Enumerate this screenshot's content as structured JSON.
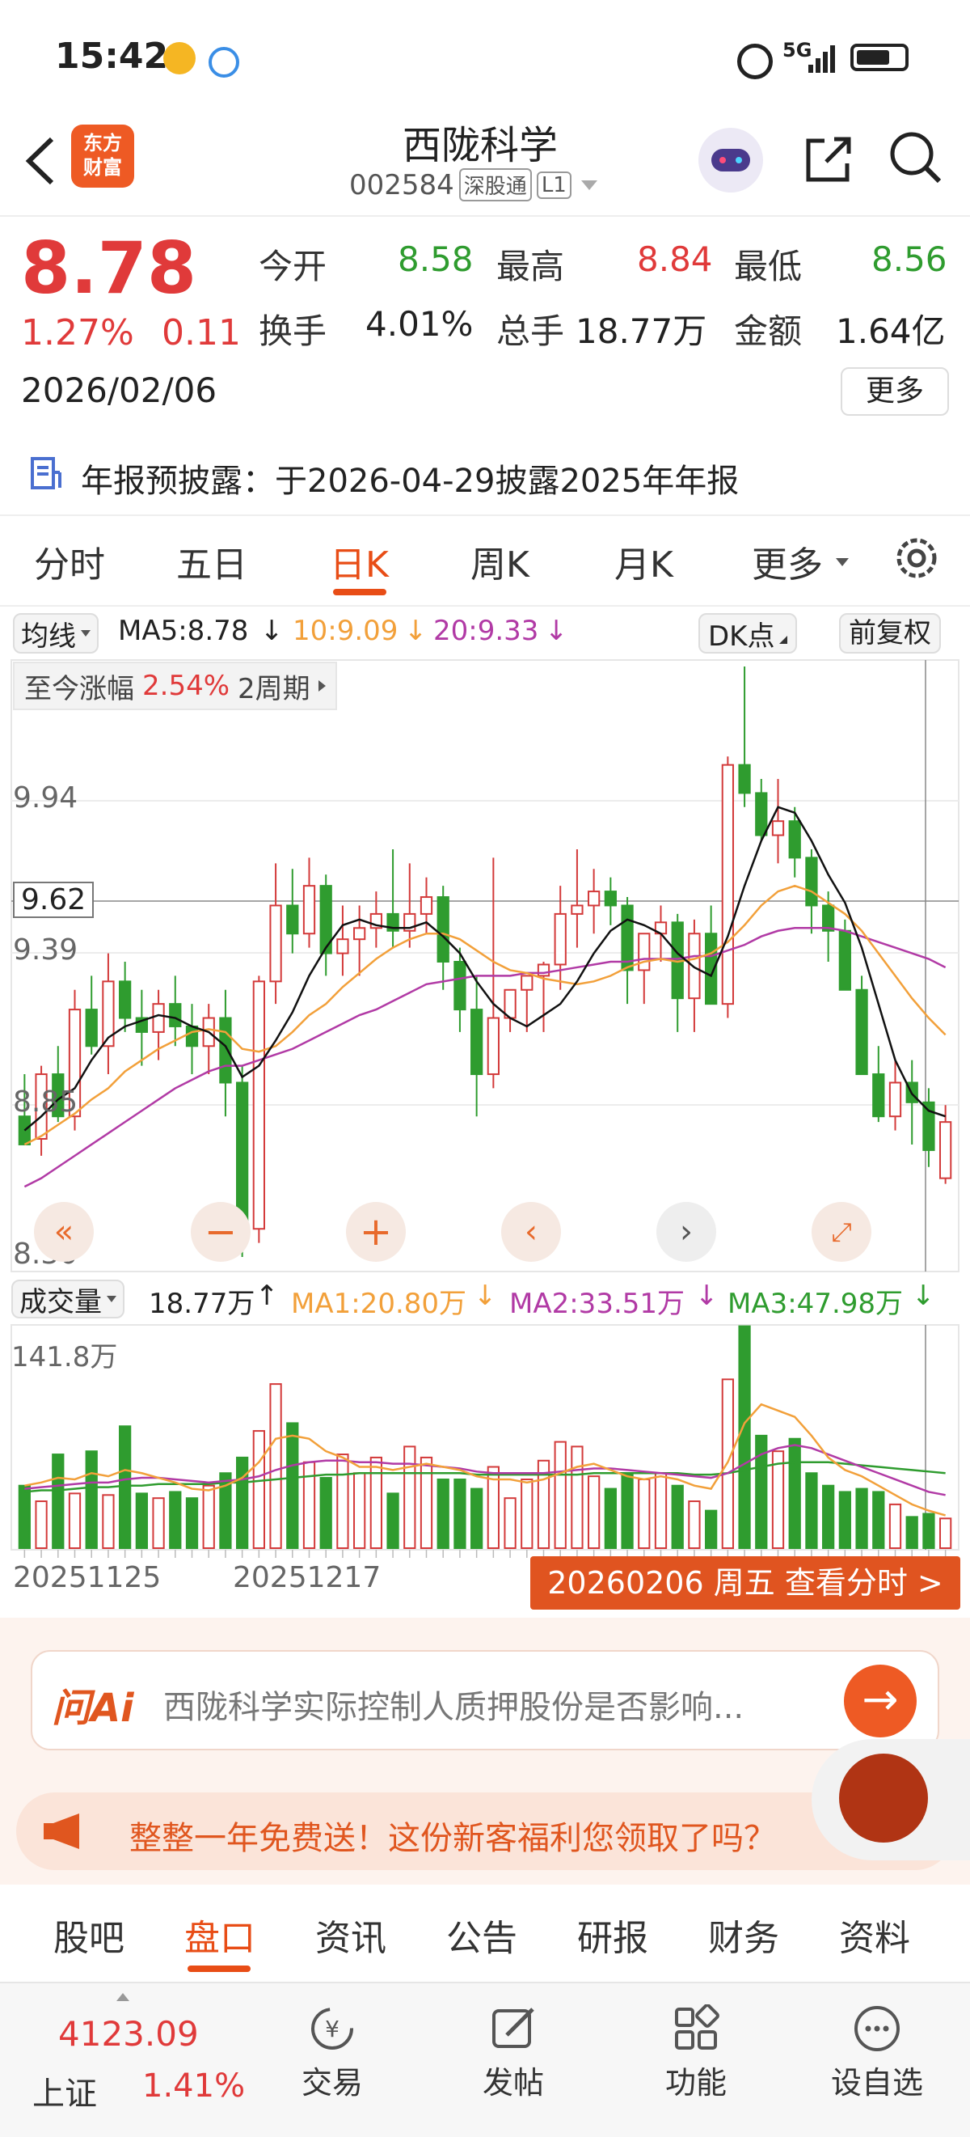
{
  "status_bar": {
    "time": "15:42",
    "network": "5G"
  },
  "header": {
    "logo_text": "东方财富",
    "stock_name": "西陇科学",
    "stock_code": "002584",
    "connect_badge": "深股通",
    "level_badge": "L1"
  },
  "quote": {
    "price": "8.78",
    "change_pct": "1.27%",
    "change_amt": "0.11",
    "date": "2026/02/06",
    "fields": [
      {
        "label": "今开",
        "value": "8.58",
        "color": "green"
      },
      {
        "label": "最高",
        "value": "8.84",
        "color": "red"
      },
      {
        "label": "最低",
        "value": "8.56",
        "color": "green"
      },
      {
        "label": "换手",
        "value": "4.01%",
        "color": "normal"
      },
      {
        "label": "总手",
        "value": "18.77万",
        "color": "normal"
      },
      {
        "label": "金额",
        "value": "1.64亿",
        "color": "normal"
      }
    ],
    "more_label": "更多"
  },
  "notice": {
    "text": "年报预披露：于2026-04-29披露2025年年报"
  },
  "chart_tabs": {
    "items": [
      "分时",
      "五日",
      "日K",
      "周K",
      "月K",
      "更多"
    ],
    "active_index": 2
  },
  "indicators": {
    "ma_selector": "均线",
    "ma5": "MA5:8.78",
    "ma10": "10:9.09",
    "ma20": "20:9.33",
    "dk_label": "DK点",
    "adjust_label": "前复权",
    "range_label": "至今涨幅",
    "range_value": "2.54%",
    "range_period": "2周期",
    "crosshair_price": "9.62"
  },
  "colors": {
    "up": "#d33a3a",
    "down": "#2f9c2f",
    "ma5": "#111111",
    "ma10": "#f2a03a",
    "ma20": "#b13aa5",
    "accent": "#e84d16"
  },
  "chart_data": [
    {
      "type": "candlestick",
      "y_ticks": [
        "9.94",
        "9.39",
        "8.85",
        "8.30"
      ],
      "ylim": [
        8.3,
        10.4
      ],
      "ohlc": [
        [
          8.8,
          8.95,
          8.72,
          8.7
        ],
        [
          8.72,
          8.98,
          8.66,
          8.95
        ],
        [
          8.95,
          9.05,
          8.78,
          8.8
        ],
        [
          8.8,
          9.25,
          8.75,
          9.18
        ],
        [
          9.18,
          9.3,
          9.02,
          9.05
        ],
        [
          9.05,
          9.38,
          8.95,
          9.28
        ],
        [
          9.28,
          9.35,
          9.1,
          9.15
        ],
        [
          9.15,
          9.25,
          8.98,
          9.1
        ],
        [
          9.1,
          9.25,
          9.0,
          9.2
        ],
        [
          9.2,
          9.3,
          9.05,
          9.12
        ],
        [
          9.12,
          9.2,
          8.95,
          9.05
        ],
        [
          9.05,
          9.2,
          8.95,
          9.15
        ],
        [
          9.15,
          9.25,
          8.8,
          8.92
        ],
        [
          8.92,
          8.98,
          8.3,
          8.4
        ],
        [
          8.4,
          9.3,
          8.35,
          9.28
        ],
        [
          9.28,
          9.7,
          9.2,
          9.55
        ],
        [
          9.55,
          9.68,
          9.38,
          9.45
        ],
        [
          9.45,
          9.72,
          9.4,
          9.62
        ],
        [
          9.62,
          9.66,
          9.3,
          9.38
        ],
        [
          9.38,
          9.55,
          9.3,
          9.43
        ],
        [
          9.43,
          9.55,
          9.3,
          9.47
        ],
        [
          9.47,
          9.6,
          9.4,
          9.52
        ],
        [
          9.52,
          9.75,
          9.4,
          9.46
        ],
        [
          9.46,
          9.7,
          9.4,
          9.52
        ],
        [
          9.52,
          9.65,
          9.45,
          9.58
        ],
        [
          9.58,
          9.62,
          9.25,
          9.35
        ],
        [
          9.35,
          9.4,
          9.1,
          9.18
        ],
        [
          9.18,
          9.3,
          8.8,
          8.95
        ],
        [
          8.95,
          9.72,
          8.9,
          9.15
        ],
        [
          9.15,
          9.25,
          9.1,
          9.25
        ],
        [
          9.25,
          9.28,
          9.1,
          9.3
        ],
        [
          9.3,
          9.35,
          9.1,
          9.34
        ],
        [
          9.34,
          9.62,
          9.25,
          9.52
        ],
        [
          9.52,
          9.75,
          9.4,
          9.55
        ],
        [
          9.55,
          9.68,
          9.45,
          9.6
        ],
        [
          9.6,
          9.65,
          9.48,
          9.55
        ],
        [
          9.55,
          9.58,
          9.2,
          9.32
        ],
        [
          9.32,
          9.45,
          9.2,
          9.45
        ],
        [
          9.45,
          9.55,
          9.35,
          9.49
        ],
        [
          9.49,
          9.52,
          9.1,
          9.22
        ],
        [
          9.22,
          9.5,
          9.1,
          9.45
        ],
        [
          9.45,
          9.55,
          9.2,
          9.2
        ],
        [
          9.2,
          10.08,
          9.15,
          10.05
        ],
        [
          10.05,
          10.4,
          9.9,
          9.95
        ],
        [
          9.95,
          10.0,
          9.78,
          9.8
        ],
        [
          9.8,
          10.0,
          9.7,
          9.85
        ],
        [
          9.85,
          9.9,
          9.65,
          9.72
        ],
        [
          9.72,
          9.75,
          9.45,
          9.55
        ],
        [
          9.55,
          9.6,
          9.35,
          9.46
        ],
        [
          9.46,
          9.5,
          9.25,
          9.25
        ],
        [
          9.25,
          9.3,
          8.95,
          8.95
        ],
        [
          8.95,
          9.05,
          8.78,
          8.8
        ],
        [
          8.8,
          9.0,
          8.75,
          8.92
        ],
        [
          8.92,
          9.0,
          8.7,
          8.85
        ],
        [
          8.85,
          8.9,
          8.62,
          8.68
        ],
        [
          8.58,
          8.84,
          8.56,
          8.78
        ]
      ],
      "ma5": [
        8.75,
        8.8,
        8.86,
        8.9,
        9.0,
        9.08,
        9.12,
        9.14,
        9.16,
        9.15,
        9.12,
        9.1,
        9.05,
        8.94,
        8.98,
        9.07,
        9.17,
        9.3,
        9.4,
        9.48,
        9.5,
        9.48,
        9.47,
        9.47,
        9.49,
        9.44,
        9.38,
        9.28,
        9.2,
        9.15,
        9.12,
        9.16,
        9.2,
        9.28,
        9.38,
        9.46,
        9.5,
        9.48,
        9.45,
        9.38,
        9.33,
        9.3,
        9.44,
        9.62,
        9.78,
        9.9,
        9.88,
        9.78,
        9.66,
        9.56,
        9.4,
        9.2,
        9.0,
        8.88,
        8.82,
        8.8
      ],
      "ma10": [
        8.7,
        8.73,
        8.77,
        8.81,
        8.86,
        8.9,
        8.96,
        9.0,
        9.04,
        9.07,
        9.1,
        9.11,
        9.1,
        9.04,
        9.03,
        9.05,
        9.1,
        9.16,
        9.2,
        9.26,
        9.31,
        9.36,
        9.4,
        9.43,
        9.45,
        9.45,
        9.43,
        9.39,
        9.35,
        9.32,
        9.31,
        9.29,
        9.28,
        9.27,
        9.28,
        9.3,
        9.33,
        9.35,
        9.36,
        9.35,
        9.36,
        9.38,
        9.42,
        9.48,
        9.55,
        9.6,
        9.62,
        9.6,
        9.56,
        9.52,
        9.46,
        9.38,
        9.3,
        9.22,
        9.15,
        9.09
      ],
      "ma20": [
        8.55,
        8.58,
        8.62,
        8.66,
        8.7,
        8.74,
        8.78,
        8.82,
        8.86,
        8.9,
        8.93,
        8.96,
        8.98,
        8.98,
        9.0,
        9.02,
        9.04,
        9.07,
        9.1,
        9.13,
        9.16,
        9.18,
        9.21,
        9.24,
        9.27,
        9.28,
        9.29,
        9.3,
        9.3,
        9.3,
        9.31,
        9.31,
        9.32,
        9.33,
        9.34,
        9.35,
        9.35,
        9.36,
        9.36,
        9.36,
        9.37,
        9.37,
        9.39,
        9.41,
        9.44,
        9.46,
        9.47,
        9.47,
        9.47,
        9.46,
        9.44,
        9.42,
        9.4,
        9.38,
        9.36,
        9.33
      ]
    },
    {
      "type": "bar",
      "title": "成交量",
      "current": "18.77万",
      "ma1": "MA1:20.80万",
      "ma2": "MA2:33.51万",
      "ma3": "MA3:47.98万",
      "y_max_label": "141.8万",
      "ylim": [
        0,
        141.8
      ],
      "values": [
        40,
        30,
        60,
        35,
        62,
        34,
        78,
        35,
        32,
        36,
        32,
        40,
        48,
        58,
        75,
        105,
        80,
        55,
        45,
        60,
        48,
        58,
        35,
        65,
        58,
        44,
        44,
        38,
        52,
        32,
        44,
        56,
        68,
        65,
        46,
        38,
        48,
        44,
        48,
        40,
        30,
        24,
        108,
        142,
        72,
        62,
        70,
        48,
        40,
        36,
        38,
        36,
        28,
        20,
        22,
        19
      ],
      "x_labels": [
        "20251125",
        "20251217"
      ],
      "ma1_line": [
        40,
        42,
        45,
        44,
        48,
        46,
        50,
        48,
        45,
        42,
        38,
        37,
        40,
        45,
        55,
        70,
        72,
        70,
        62,
        58,
        52,
        52,
        50,
        52,
        54,
        52,
        50,
        46,
        44,
        44,
        42,
        44,
        48,
        52,
        54,
        50,
        46,
        44,
        46,
        44,
        40,
        38,
        55,
        80,
        92,
        88,
        84,
        72,
        58,
        50,
        46,
        40,
        34,
        28,
        24,
        21
      ],
      "ma2_line": [
        38,
        39,
        40,
        41,
        42,
        42,
        44,
        45,
        45,
        44,
        43,
        42,
        43,
        44,
        46,
        50,
        53,
        55,
        56,
        56,
        55,
        55,
        54,
        54,
        53,
        52,
        51,
        49,
        48,
        48,
        48,
        48,
        49,
        50,
        51,
        51,
        50,
        49,
        48,
        47,
        46,
        45,
        48,
        54,
        60,
        64,
        66,
        64,
        60,
        56,
        52,
        48,
        44,
        40,
        36,
        34
      ],
      "ma3_line": [
        36,
        37,
        37,
        38,
        39,
        39,
        40,
        40,
        41,
        41,
        41,
        41,
        42,
        42,
        43,
        44,
        45,
        46,
        47,
        47,
        48,
        48,
        48,
        48,
        48,
        48,
        48,
        47,
        47,
        47,
        47,
        47,
        47,
        47,
        48,
        48,
        48,
        48,
        48,
        48,
        47,
        47,
        48,
        50,
        52,
        54,
        55,
        55,
        55,
        54,
        53,
        52,
        51,
        50,
        49,
        48
      ]
    }
  ],
  "date_bar": {
    "label": "20260206 周五 查看分时 >"
  },
  "ai_bar": {
    "logo": "问Ai",
    "placeholder": "西陇科学实际控制人质押股份是否影响..."
  },
  "promo": {
    "text": "整整一年免费送！这份新客福利您领取了吗？"
  },
  "section_tabs": {
    "items": [
      "股吧",
      "盘口",
      "资讯",
      "公告",
      "研报",
      "财务",
      "资料"
    ],
    "active_index": 1
  },
  "bottom_nav": {
    "index_value": "4123.09",
    "index_name": "上证",
    "index_change": "1.41%",
    "items": [
      "交易",
      "发帖",
      "功能",
      "设自选"
    ]
  }
}
